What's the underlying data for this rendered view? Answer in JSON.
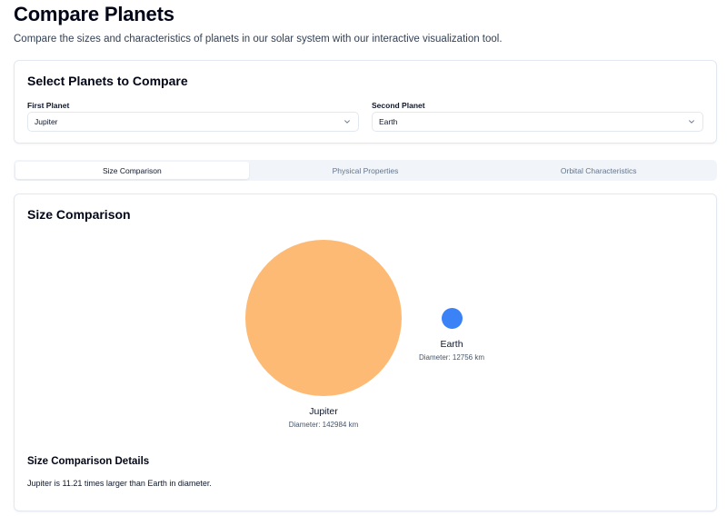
{
  "header": {
    "title": "Compare Planets",
    "subtitle": "Compare the sizes and characteristics of planets in our solar system with our interactive visualization tool."
  },
  "selection": {
    "title": "Select Planets to Compare",
    "first_label": "First Planet",
    "first_value": "Jupiter",
    "second_label": "Second Planet",
    "second_value": "Earth",
    "chevron_icon": "chevron-down-icon"
  },
  "tabs": [
    {
      "label": "Size Comparison",
      "active": true
    },
    {
      "label": "Physical Properties",
      "active": false
    },
    {
      "label": "Orbital Characteristics",
      "active": false
    }
  ],
  "size_comparison": {
    "title": "Size Comparison",
    "planets": [
      {
        "name": "Jupiter",
        "diameter_text": "Diameter: 142984 km",
        "color": "#fdba74"
      },
      {
        "name": "Earth",
        "diameter_text": "Diameter: 12756 km",
        "color": "#3b82f6"
      }
    ],
    "details_title": "Size Comparison Details",
    "details_text": "Jupiter is 11.21 times larger than Earth in diameter."
  }
}
